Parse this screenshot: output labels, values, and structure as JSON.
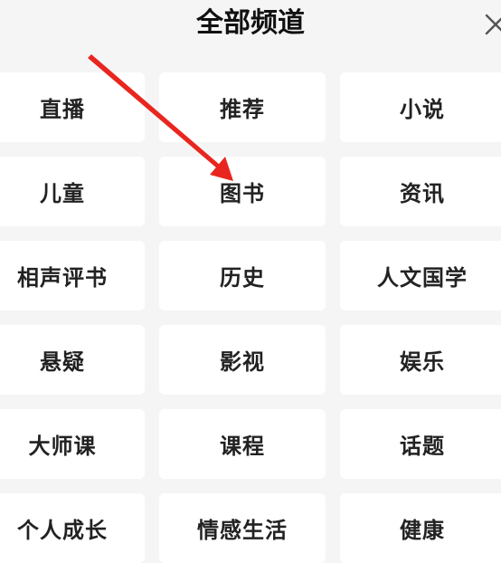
{
  "header": {
    "title": "全部频道",
    "close_icon": "close-icon"
  },
  "channels": [
    {
      "label": "直播"
    },
    {
      "label": "推荐"
    },
    {
      "label": "小说"
    },
    {
      "label": "儿童"
    },
    {
      "label": "图书"
    },
    {
      "label": "资讯"
    },
    {
      "label": "相声评书"
    },
    {
      "label": "历史"
    },
    {
      "label": "人文国学"
    },
    {
      "label": "悬疑"
    },
    {
      "label": "影视"
    },
    {
      "label": "娱乐"
    },
    {
      "label": "大师课"
    },
    {
      "label": "课程"
    },
    {
      "label": "话题"
    },
    {
      "label": "个人成长"
    },
    {
      "label": "情感生活"
    },
    {
      "label": "健康"
    }
  ],
  "annotation": {
    "arrow_color": "#e8261f"
  }
}
